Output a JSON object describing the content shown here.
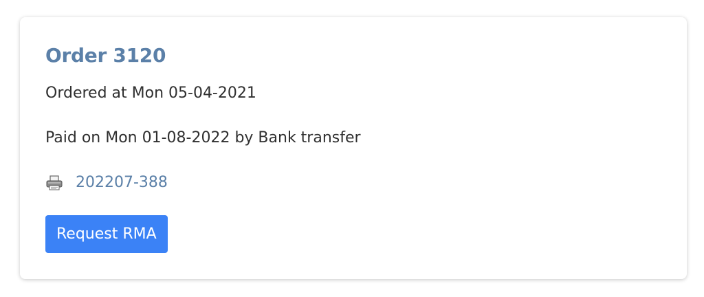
{
  "order": {
    "title": "Order 3120",
    "ordered_text": "Ordered at Mon 05-04-2021",
    "paid_text": "Paid on Mon 01-08-2022 by Bank transfer",
    "invoice": {
      "icon": "printer-icon",
      "number": "202207-388"
    },
    "rma_button_label": "Request RMA"
  },
  "colors": {
    "title": "#5b80a8",
    "link": "#5b80a8",
    "button_bg": "#3b82f6",
    "button_text": "#ffffff",
    "body_text": "#2f2f2f"
  }
}
